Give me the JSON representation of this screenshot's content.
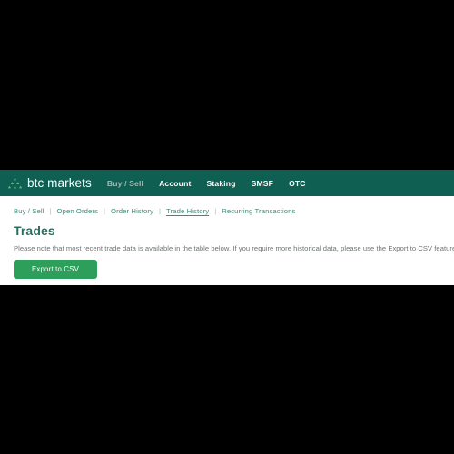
{
  "colors": {
    "topbar_bg": "#0f5f53",
    "button_green": "#2e9e5b",
    "heading_green": "#2d6b5c",
    "link_green": "#3f8a78",
    "letterbox": "#000000",
    "page_bg": "#ffffff"
  },
  "header": {
    "logo_icon": "triangle-dots-icon",
    "brand_name": "btc markets",
    "nav": [
      {
        "label": "Buy / Sell",
        "muted": true
      },
      {
        "label": "Account",
        "muted": false
      },
      {
        "label": "Staking",
        "muted": false
      },
      {
        "label": "SMSF",
        "muted": false
      },
      {
        "label": "OTC",
        "muted": false
      }
    ]
  },
  "subnav": {
    "separator": "|",
    "items": [
      {
        "label": "Buy / Sell",
        "active": false
      },
      {
        "label": "Open Orders",
        "active": false
      },
      {
        "label": "Order History",
        "active": false
      },
      {
        "label": "Trade History",
        "active": true
      },
      {
        "label": "Recurring Transactions",
        "active": false
      }
    ]
  },
  "main": {
    "title": "Trades",
    "note": "Please note that most recent trade data is available in the table below. If you require more historical data, please use the Export to CSV feature.",
    "export_button": "Export to CSV"
  }
}
